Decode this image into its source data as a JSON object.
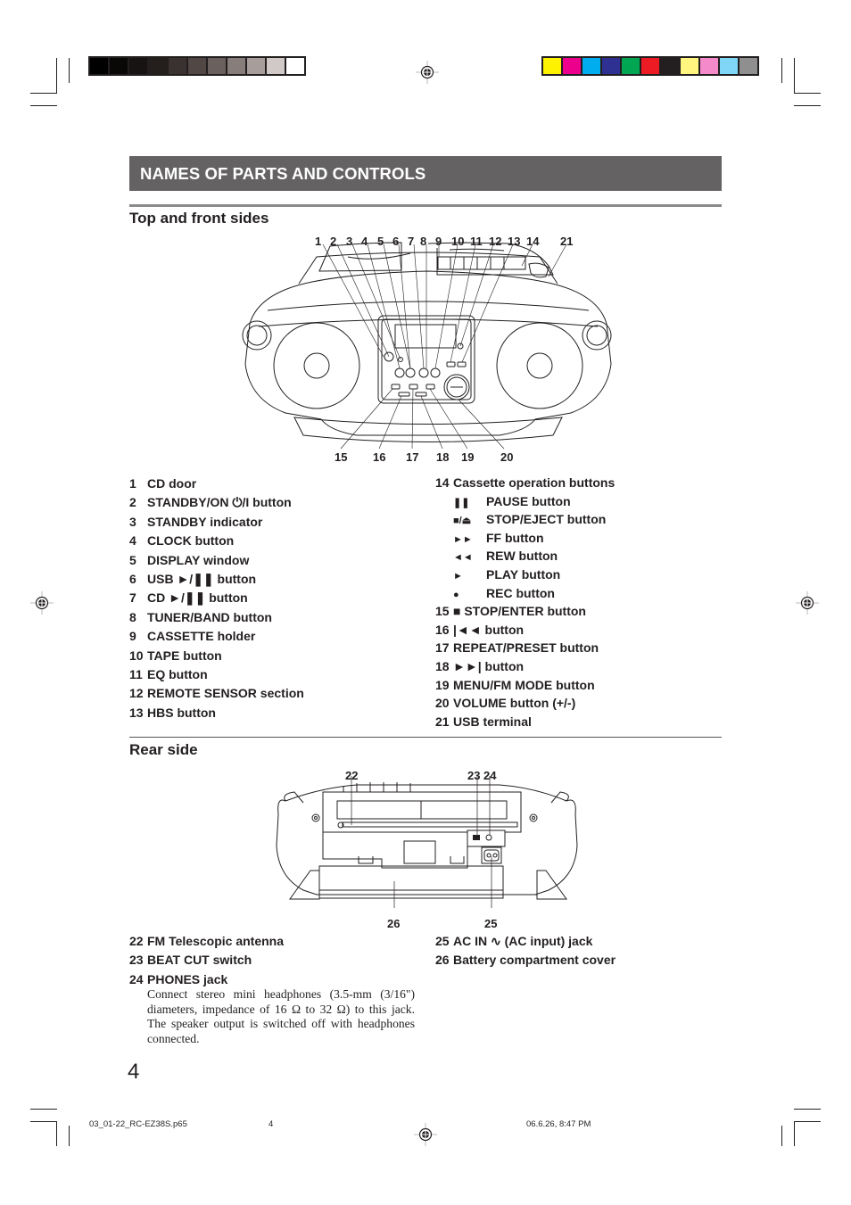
{
  "color_bars": {
    "grayscale": [
      "#000000",
      "#0a0807",
      "#171312",
      "#241f1d",
      "#3a3230",
      "#514845",
      "#6a605d",
      "#877d7a",
      "#a79e9c",
      "#d1c9c8",
      "#ffffff"
    ],
    "process": [
      "#fff200",
      "#ec008c",
      "#00aeef",
      "#2e3192",
      "#00a651",
      "#ed1c24",
      "#231f20",
      "#fff57f",
      "#f58acb",
      "#7fd6f7",
      "#8f8f8f"
    ]
  },
  "header": {
    "title": "NAMES OF PARTS AND CONTROLS"
  },
  "top_front": {
    "title": "Top and front sides",
    "callouts_top": [
      "1",
      "2",
      "3",
      "4",
      "5",
      "6",
      "7",
      "8",
      "9",
      "10",
      "11",
      "12",
      "13",
      "14",
      "21"
    ],
    "callouts_bottom": [
      "15",
      "16",
      "17",
      "18",
      "19",
      "20"
    ],
    "left_list": [
      {
        "num": "1",
        "label": "CD door"
      },
      {
        "num": "2",
        "label": "STANDBY/ON ⏻/I button"
      },
      {
        "num": "3",
        "label": "STANDBY indicator"
      },
      {
        "num": "4",
        "label": "CLOCK button"
      },
      {
        "num": "5",
        "label": "DISPLAY window"
      },
      {
        "num": "6",
        "label": "USB ►/❚❚ button"
      },
      {
        "num": "7",
        "label": "CD ►/❚❚ button"
      },
      {
        "num": "8",
        "label": "TUNER/BAND button"
      },
      {
        "num": "9",
        "label": "CASSETTE holder"
      },
      {
        "num": "10",
        "label": "TAPE button"
      },
      {
        "num": "11",
        "label": "EQ button"
      },
      {
        "num": "12",
        "label": "REMOTE SENSOR section"
      },
      {
        "num": "13",
        "label": "HBS button"
      }
    ],
    "cassette_heading": {
      "num": "14",
      "label": "Cassette operation buttons"
    },
    "cassette_buttons": [
      {
        "symbol": "❚❚",
        "symbol_name": "pause-icon",
        "label": "PAUSE button"
      },
      {
        "symbol": "■/⏏",
        "symbol_name": "stop-eject-icon",
        "label": "STOP/EJECT button"
      },
      {
        "symbol": "►►",
        "symbol_name": "fast-forward-icon",
        "label": "FF button"
      },
      {
        "symbol": "◄◄",
        "symbol_name": "rewind-icon",
        "label": "REW button"
      },
      {
        "symbol": "►",
        "symbol_name": "play-icon",
        "label": "PLAY button"
      },
      {
        "symbol": "●",
        "symbol_name": "record-icon",
        "label": "REC button"
      }
    ],
    "right_list": [
      {
        "num": "15",
        "label": "■ STOP/ENTER button"
      },
      {
        "num": "16",
        "label": "|◄◄ button"
      },
      {
        "num": "17",
        "label": "REPEAT/PRESET button"
      },
      {
        "num": "18",
        "label": "►►| button"
      },
      {
        "num": "19",
        "label": "MENU/FM MODE button"
      },
      {
        "num": "20",
        "label": "VOLUME button (+/-)"
      },
      {
        "num": "21",
        "label": "USB terminal"
      }
    ]
  },
  "rear": {
    "title": "Rear side",
    "callouts": [
      "22",
      "23",
      "24",
      "26",
      "25"
    ],
    "left_list": [
      {
        "num": "22",
        "label": "FM Telescopic antenna"
      },
      {
        "num": "23",
        "label": "BEAT CUT switch"
      },
      {
        "num": "24",
        "label": "PHONES jack"
      }
    ],
    "phones_description": "Connect stereo mini headphones (3.5-mm (3/16\") diameters, impedance of 16 Ω to 32 Ω) to this jack. The speaker output is switched off with headphones connected.",
    "right_list": [
      {
        "num": "25",
        "label": "AC IN ∿ (AC input) jack"
      },
      {
        "num": "26",
        "label": "Battery compartment cover"
      }
    ]
  },
  "page_number": "4",
  "footer": {
    "filename": "03_01-22_RC-EZ38S.p65",
    "page": "4",
    "timestamp": "06.6.26, 8:47 PM"
  }
}
